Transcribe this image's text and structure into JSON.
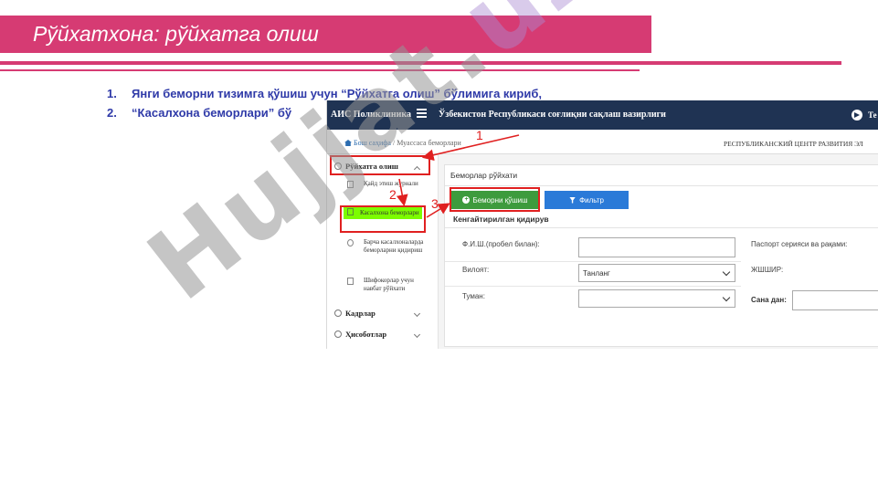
{
  "slide": {
    "title": "Рўйхатхона: рўйхатга олиш",
    "steps": [
      {
        "num": "1.",
        "text": "Янги беморни тизимга қўшиш учун “Рўйхатга олиш” бўлимига кириб,"
      },
      {
        "num": "2.",
        "text": "“Касалхона беморлари” бў"
      }
    ]
  },
  "app": {
    "name": "АИС Поликлиника",
    "ministry": "Ўзбекистон Республикаси соғлиқни сақлаш вазирлиги",
    "telegram_label": "Те",
    "breadcrumb": {
      "home": "Бош саҳифа",
      "separator": "/",
      "current": "Муассаса беморлари"
    },
    "org": "РЕСПУБЛИКАНСКИЙ ЦЕНТР РАЗВИТИЯ ЭЛ",
    "sidebar": {
      "registration": "Рўйхатга олиш",
      "items": [
        {
          "label": "Қайд этиш журнали"
        },
        {
          "label": "Касалхона беморлари"
        },
        {
          "label": "Барча касалхоналарда беморларни қидириш"
        },
        {
          "label": "Шифокорлар учун навбат рўйхати"
        }
      ],
      "staff": "Кадрлар",
      "reports": "Ҳисоботлар"
    },
    "main": {
      "card_title": "Беморлар рўйхати",
      "add_button": "Беморни қўшиш",
      "filter_button": "Фильтр",
      "advanced_search": "Кенгайтирилган қидирув",
      "fields": {
        "fio_label": "Ф.И.Ш.(пробел билан):",
        "passport_label": "Паспорт серияси ва рақами:",
        "region_label": "Вилоят:",
        "region_value": "Танланг",
        "jshshir_label": "ЖШШИР:",
        "district_label": "Туман:",
        "district_value": "",
        "date_label": "Сана дан:"
      }
    }
  },
  "annotations": [
    "1",
    "2",
    "3"
  ],
  "watermark": {
    "main": "Hujjat.",
    "accent": "uz"
  },
  "colors": {
    "accent": "#d63b73",
    "steps": "#2f3aa8",
    "topbar": "#1f3353",
    "add_button": "#3d9b3d",
    "filter_button": "#2a7ad8",
    "highlight": "#7cfc00",
    "annotation": "#e02020"
  }
}
